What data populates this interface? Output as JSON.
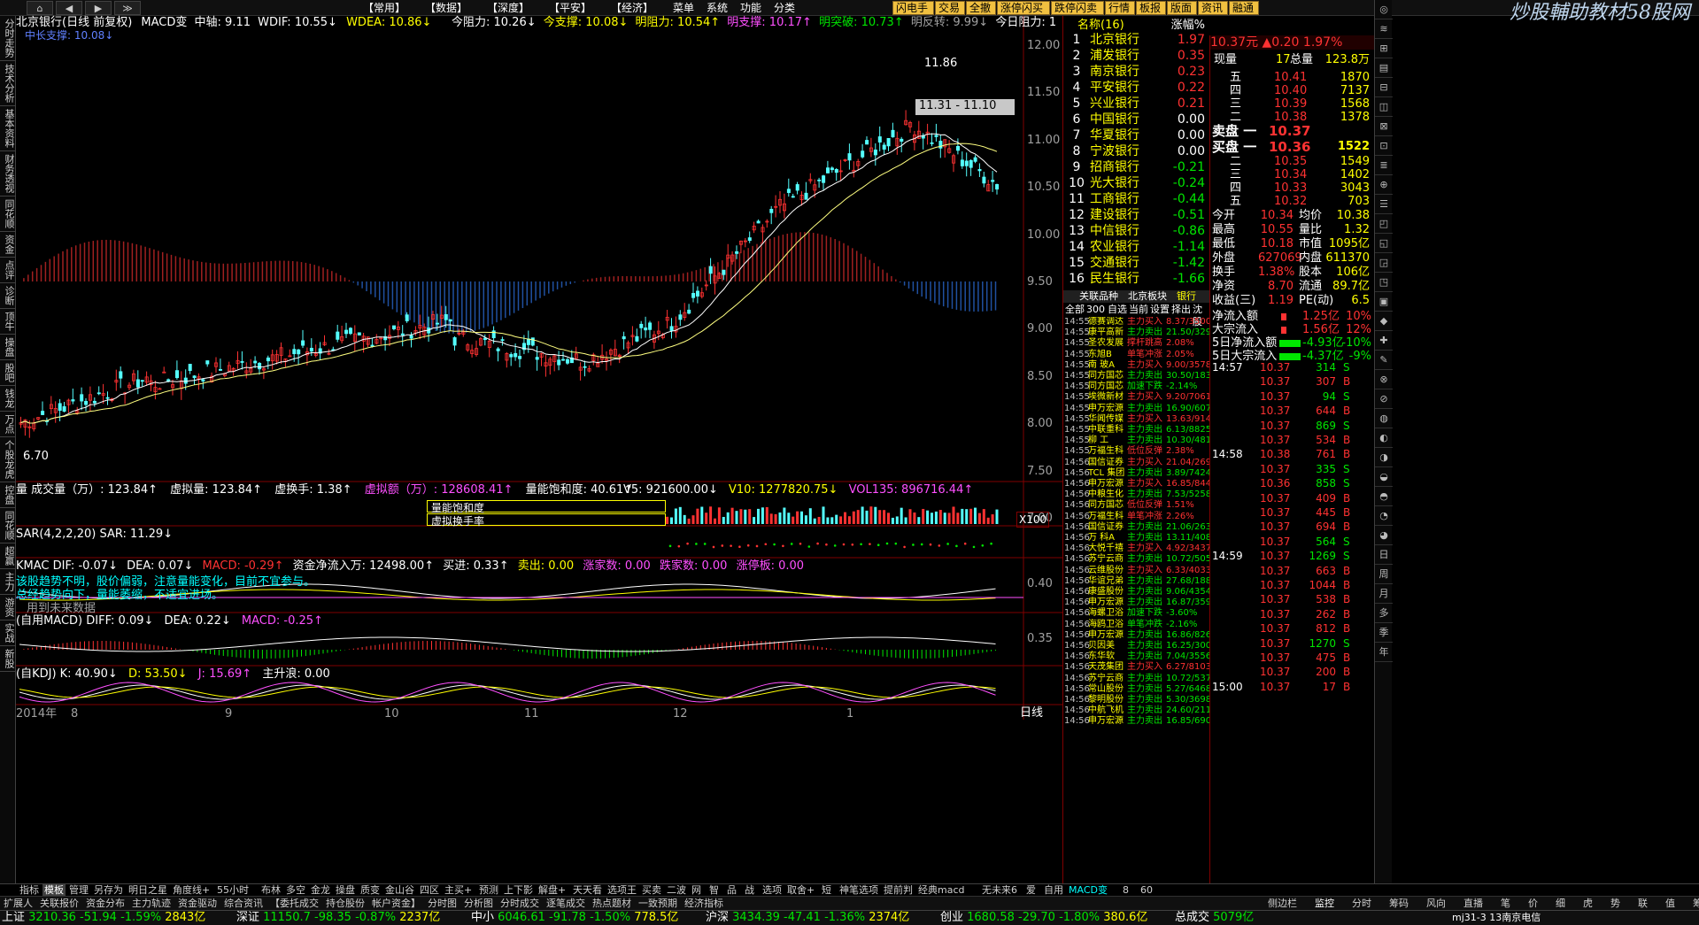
{
  "topbar": {
    "nav_buttons": [
      "⌂",
      "◀",
      "▶",
      "≫"
    ],
    "menus": [
      "【常用】",
      "【数据】",
      "【深度】",
      "【平安】",
      "【经济】",
      "菜单",
      "系统",
      "功能",
      "分类"
    ],
    "quick_buttons": [
      "闪电手",
      "交易",
      "全撤",
      "涨停闪买",
      "跌停闪卖",
      "行情",
      "板报",
      "版面",
      "资讯",
      "融通"
    ]
  },
  "logo": "炒股輔助教材58股网",
  "left_tabs": [
    "分时走势",
    "技术分析",
    "基本资料",
    "财务透视",
    "同花顺",
    "资金",
    "点评",
    "诊断",
    "顶牛",
    "操盘",
    "股吧",
    "钱龙",
    "万点",
    "个股龙虎",
    "控盘",
    "同花顺",
    "超赢",
    "主力",
    "游资",
    "实战",
    "新股"
  ],
  "chart": {
    "header": {
      "stock": "北京银行(日线 前复权)",
      "indicator": "MACD变",
      "mid": "中轴: 9.11",
      "wdif": "WDIF: 10.55↓",
      "wdea": "WDEA: 10.86↓",
      "today_resist": "今阻力: 10.26↓",
      "today_support": "今支撑: 10.08↓",
      "tmr_resist": "明阻力: 10.54↑",
      "tmr_support": "明支撑: 10.17↑",
      "tmr_break": "明突破: 10.73↑",
      "tmr_rev": "明反转: 9.99↓",
      "today_resist2": "今日阻力: 1"
    },
    "sub_label": "中长支撑: 10.08↓",
    "price_high_label": "11.86",
    "price_low_label": "6.70",
    "range_label": "11.31 - 11.10",
    "y_ticks": [
      "12.00",
      "11.50",
      "11.00",
      "10.50",
      "10.00",
      "9.50",
      "9.00",
      "8.50",
      "8.00",
      "7.50",
      "7.00"
    ],
    "volume_header": {
      "label": "量 成交量（万）: 123.84↑",
      "virtual": "虚拟量: 123.84↑",
      "turnover": "虚换手: 1.38↑",
      "vamount": "虚拟额（万）: 128608.41↑",
      "saturation": "量能饱和度: 40.61↑",
      "v5": "V5: 921600.00↓",
      "v10": "V10: 1277820.75↓",
      "vol135": "VOL135: 896716.44↑"
    },
    "vol_box_labels": [
      "量能饱和度",
      "虚拟换手率"
    ],
    "vol_scale": "X100",
    "sar_header": "SAR(4,2,2,20) SAR: 11.29↓",
    "kmac_header": {
      "label": "KMAC DIF: -0.07↓",
      "dea": "DEA: 0.07↓",
      "macd": "MACD: -0.29↑",
      "inflow": "资金净流入万: 12498.00↑",
      "buy": "买进: 0.33↑",
      "sell": "卖出: 0.00",
      "up": "涨家数: 0.00",
      "down": "跌家数: 0.00",
      "limit": "涨停板: 0.00"
    },
    "kmac_tip1": "该股趋势不明，股价偏弱，注意量能变化，目前不宜参与。",
    "kmac_tip2": "总经趋势向下，量能萎缩，不适宜进场。",
    "kmac_tip3": "用到未来数据",
    "kmac_scale": "0.40",
    "macd_header": {
      "label": "(自用MACD) DIFF: 0.09↓",
      "dea": "DEA: 0.22↓",
      "macd": "MACD: -0.25↑"
    },
    "macd_scale": "0.35",
    "kdj_header": {
      "label": "(自KDJ) K: 40.90↓",
      "d": "D: 53.50↓",
      "j": "J: 15.69↑",
      "main": "主升浪: 0.00"
    },
    "x_labels": [
      "2014年",
      "8",
      "9",
      "10",
      "11",
      "12",
      "1"
    ],
    "period": "日线"
  },
  "stock_list": {
    "header_name": "名称(16)",
    "header_pct": "涨幅%",
    "rows": [
      {
        "n": "1",
        "name": "北京银行",
        "pct": "1.97",
        "up": true
      },
      {
        "n": "2",
        "name": "浦发银行",
        "pct": "0.35",
        "up": true
      },
      {
        "n": "3",
        "name": "南京银行",
        "pct": "0.23",
        "up": true
      },
      {
        "n": "4",
        "name": "平安银行",
        "pct": "0.22",
        "up": true
      },
      {
        "n": "5",
        "name": "兴业银行",
        "pct": "0.21",
        "up": true
      },
      {
        "n": "6",
        "name": "中国银行",
        "pct": "0.00",
        "up": null
      },
      {
        "n": "7",
        "name": "华夏银行",
        "pct": "0.00",
        "up": null
      },
      {
        "n": "8",
        "name": "宁波银行",
        "pct": "0.00",
        "up": null
      },
      {
        "n": "9",
        "name": "招商银行",
        "pct": "-0.21",
        "up": false
      },
      {
        "n": "10",
        "name": "光大银行",
        "pct": "-0.24",
        "up": false
      },
      {
        "n": "11",
        "name": "工商银行",
        "pct": "-0.44",
        "up": false
      },
      {
        "n": "12",
        "name": "建设银行",
        "pct": "-0.51",
        "up": false
      },
      {
        "n": "13",
        "name": "中信银行",
        "pct": "-0.86",
        "up": false
      },
      {
        "n": "14",
        "name": "农业银行",
        "pct": "-1.14",
        "up": false
      },
      {
        "n": "15",
        "name": "交通银行",
        "pct": "-1.42",
        "up": false
      },
      {
        "n": "16",
        "name": "民生银行",
        "pct": "-1.66",
        "up": false
      }
    ],
    "tabs": [
      "关联品种",
      "北京板块",
      "银行"
    ],
    "filter_tabs": [
      "全部",
      "300",
      "自选",
      "当前",
      "设置",
      "择出",
      "沈股"
    ],
    "feed": [
      [
        "14:55",
        "德赛调达",
        "主力买入",
        "8.37/3500"
      ],
      [
        "14:55",
        "康平高新",
        "主力卖出",
        "21.50/3293"
      ],
      [
        "14:55",
        "圣农发展",
        "撑杆跳高",
        "2.08%"
      ],
      [
        "14:55",
        "东旭B",
        "单笔冲涨",
        "2.05%"
      ],
      [
        "14:55",
        "南 玻A",
        "主力买入",
        "9.00/3578"
      ],
      [
        "14:55",
        "同方国芯",
        "主力卖出",
        "30.50/1838"
      ],
      [
        "14:55",
        "同方国芯",
        "加速下跌",
        "-2.14%"
      ],
      [
        "14:55",
        "埃微新材",
        "主力买入",
        "9.20/7061"
      ],
      [
        "14:55",
        "申万宏源",
        "主力卖出",
        "16.90/6078"
      ],
      [
        "14:55",
        "华闻传媒",
        "主力买入",
        "13.63/9140"
      ],
      [
        "14:55",
        "中联重科",
        "主力卖出",
        "6.13/8825"
      ],
      [
        "14:55",
        "柳 工",
        "主力卖出",
        "10.30/4813"
      ],
      [
        "14:55",
        "万福生科",
        "低位反弹",
        "2.38%"
      ],
      [
        "14:56",
        "国信证券",
        "主力买入",
        "21.04/2693"
      ],
      [
        "14:56",
        "TCL 集团",
        "主力卖出",
        "3.89/7424"
      ],
      [
        "14:56",
        "申万宏源",
        "主力买入",
        "16.85/8441"
      ],
      [
        "14:56",
        "中粮生化",
        "主力卖出",
        "7.53/5258"
      ],
      [
        "14:56",
        "同方国芯",
        "低位反弹",
        "1.51%"
      ],
      [
        "14:56",
        "万福生科",
        "单笔冲涨",
        "2.26%"
      ],
      [
        "14:56",
        "国信证券",
        "主力卖出",
        "21.06/2636"
      ],
      [
        "14:56",
        "万 科A",
        "主力卖出",
        "13.11/4087"
      ],
      [
        "14:56",
        "大悦千禧",
        "主力买入",
        "4.92/3437"
      ],
      [
        "14:56",
        "苏宁云商",
        "主力卖出",
        "10.72/5054"
      ],
      [
        "14:56",
        "云维股份",
        "主力买入",
        "6.33/4033"
      ],
      [
        "14:56",
        "华谊兄弟",
        "主力卖出",
        "27.68/1883"
      ],
      [
        "14:56",
        "康盛股份",
        "主力卖出",
        "9.06/4354"
      ],
      [
        "14:56",
        "申万宏源",
        "主力卖出",
        "16.87/3595"
      ],
      [
        "14:56",
        "海螺卫浴",
        "加速下跌",
        "-3.60%"
      ],
      [
        "14:56",
        "海鸥卫浴",
        "单笔冲跌",
        "-2.16%"
      ],
      [
        "14:56",
        "申万宏源",
        "主力卖出",
        "16.86/8268"
      ],
      [
        "14:56",
        "贝因美",
        "主力卖出",
        "16.25/3009"
      ],
      [
        "14:56",
        "东华软",
        "主力卖出",
        "7.04/3556"
      ],
      [
        "14:56",
        "天茂集团",
        "主力买入",
        "6.27/8103"
      ],
      [
        "14:56",
        "苏宁云商",
        "主力卖出",
        "10.72/5372"
      ],
      [
        "14:56",
        "常山股份",
        "主力卖出",
        "5.27/6468"
      ],
      [
        "14:56",
        "黎明股份",
        "主力卖出",
        "5.30/3698"
      ],
      [
        "14:56",
        "中航飞机",
        "主力卖出",
        "24.60/2119"
      ],
      [
        "14:56",
        "申万宏源",
        "主力卖出",
        "16.85/6901"
      ]
    ]
  },
  "quote": {
    "price_head": "10.37元 ▲0.20 1.97%",
    "now_vol": {
      "label": "现量",
      "val": "17",
      "label2": "总量",
      "val2": "123.8万"
    },
    "sell": [
      {
        "lv": "五",
        "p": "10.41",
        "v": "1870"
      },
      {
        "lv": "四",
        "p": "10.40",
        "v": "7137"
      },
      {
        "lv": "三",
        "p": "10.39",
        "v": "1568"
      },
      {
        "lv": "二",
        "p": "10.38",
        "v": "1378"
      }
    ],
    "sell1": {
      "label": "卖盘 一",
      "p": "10.37",
      "v": ""
    },
    "buy1": {
      "label": "买盘 一",
      "p": "10.36",
      "v": "1522"
    },
    "buy": [
      {
        "lv": "二",
        "p": "10.35",
        "v": "1549"
      },
      {
        "lv": "三",
        "p": "10.34",
        "v": "1402"
      },
      {
        "lv": "四",
        "p": "10.33",
        "v": "3043"
      },
      {
        "lv": "五",
        "p": "10.32",
        "v": "703"
      }
    ],
    "stats": [
      [
        "今开",
        "10.34",
        "均价",
        "10.38"
      ],
      [
        "最高",
        "10.55",
        "量比",
        "1.32"
      ],
      [
        "最低",
        "10.18",
        "市值",
        "1095亿"
      ],
      [
        "外盘",
        "627069",
        "内盘",
        "611370"
      ],
      [
        "换手",
        "1.38%",
        "股本",
        "106亿"
      ],
      [
        "净资",
        "8.70",
        "流通",
        "89.7亿"
      ],
      [
        "收益(三)",
        "1.19",
        "PE(动)",
        "6.5"
      ]
    ],
    "flows": [
      [
        "净流入额",
        "1.25亿",
        "10%"
      ],
      [
        "大宗流入",
        "1.56亿",
        "12%"
      ],
      [
        "5日净流入额",
        "-4.93亿",
        "-10%"
      ],
      [
        "5日大宗流入",
        "-4.37亿",
        "-9%"
      ]
    ],
    "ticks": [
      [
        "14:57",
        "10.37",
        "314",
        "S"
      ],
      [
        "",
        "10.37",
        "307",
        "B"
      ],
      [
        "",
        "10.37",
        "94",
        "S"
      ],
      [
        "",
        "10.37",
        "644",
        "B"
      ],
      [
        "",
        "10.37",
        "869",
        "S"
      ],
      [
        "",
        "10.37",
        "534",
        "B"
      ],
      [
        "14:58",
        "10.38",
        "761",
        "B"
      ],
      [
        "",
        "10.37",
        "335",
        "S"
      ],
      [
        "",
        "10.36",
        "858",
        "S"
      ],
      [
        "",
        "10.37",
        "409",
        "B"
      ],
      [
        "",
        "10.37",
        "445",
        "B"
      ],
      [
        "",
        "10.37",
        "694",
        "B"
      ],
      [
        "",
        "10.37",
        "564",
        "S"
      ],
      [
        "14:59",
        "10.37",
        "1269",
        "S"
      ],
      [
        "",
        "10.37",
        "663",
        "B"
      ],
      [
        "",
        "10.37",
        "1044",
        "B"
      ],
      [
        "",
        "10.37",
        "538",
        "B"
      ],
      [
        "",
        "10.37",
        "262",
        "B"
      ],
      [
        "",
        "10.37",
        "812",
        "B"
      ],
      [
        "",
        "10.37",
        "1270",
        "S"
      ],
      [
        "",
        "10.37",
        "475",
        "B"
      ],
      [
        "",
        "10.37",
        "200",
        "B"
      ],
      [
        "15:00",
        "10.37",
        "17",
        "B"
      ]
    ]
  },
  "right_tools": [
    "◎",
    "≋",
    "⊞",
    "▤",
    "⊟",
    "◫",
    "⊠",
    "⊡",
    "≣",
    "⊕",
    "☰",
    "◰",
    "◱",
    "◲",
    "◳",
    "▣",
    "◆",
    "✚",
    "✎",
    "⊗",
    "⊘",
    "◍",
    "◐",
    "◑",
    "◒",
    "◓",
    "◔",
    "◕",
    "日",
    "周",
    "月",
    "多",
    "季",
    "年"
  ],
  "bottom_tabs1": [
    "指标",
    "模板",
    "管理",
    "另存为",
    "明日之星",
    "角度线+",
    "55小时",
    "布林",
    "多空",
    "金龙",
    "操盘",
    "质变",
    "金山谷",
    "四区",
    "主买+",
    "预测",
    "上下影",
    "解盘+",
    "天天看",
    "选项王",
    "买卖",
    "二波",
    "网",
    "智",
    "品",
    "战",
    "选项",
    "取舍+",
    "短",
    "神笔选项",
    "提前判",
    "经典macd",
    "无未来6",
    "爱",
    "自用",
    "MACD变",
    "8",
    "60"
  ],
  "bottom_tabs2": [
    "扩展人",
    "关联报价",
    "资金分布",
    "主力轨迹",
    "资金驱动",
    "综合资讯",
    "【委托成交",
    "持仓股份",
    "帐户资金】",
    "分时图",
    "分析图",
    "分时成交",
    "逐笔成交",
    "热点题材",
    "一致预期",
    "经济指标"
  ],
  "bottom_tabs_right": [
    "侧边栏",
    "监控",
    "分时",
    "筹码",
    "风向",
    "直播",
    "笔",
    "价",
    "细",
    "虎",
    "势",
    "联",
    "值",
    "筹"
  ],
  "status": [
    {
      "name": "上证",
      "val": "3210.36",
      "chg": "-51.94",
      "pct": "-1.59%",
      "amt": "2843亿"
    },
    {
      "name": "深证",
      "val": "11150.7",
      "chg": "-98.35",
      "pct": "-0.87%",
      "amt": "2237亿"
    },
    {
      "name": "中小",
      "val": "6046.61",
      "chg": "-91.78",
      "pct": "-1.50%",
      "amt": "778.5亿"
    },
    {
      "name": "沪深",
      "val": "3434.39",
      "chg": "-47.41",
      "pct": "-1.36%",
      "amt": "2374亿"
    },
    {
      "name": "创业",
      "val": "1680.58",
      "chg": "-29.70",
      "pct": "-1.80%",
      "amt": "380.6亿"
    },
    {
      "name": "总成交",
      "val": "5079亿",
      "chg": "",
      "pct": "",
      "amt": ""
    }
  ],
  "status_tail": "mj31-3 13南京电信",
  "colors": {
    "up": "#ff3232",
    "down": "#54ffff",
    "bg": "#000000",
    "grid": "#800000",
    "ma": "#ffffff",
    "accent": "#ffff00"
  }
}
